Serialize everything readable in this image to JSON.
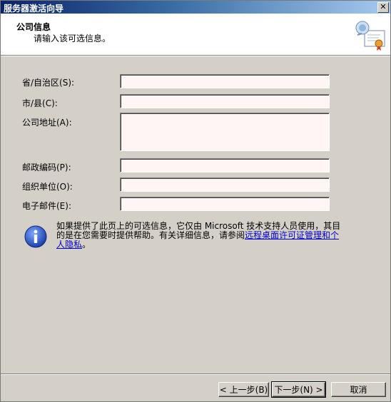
{
  "window": {
    "title": "服务器激活向导",
    "close": "✕"
  },
  "header": {
    "title": "公司信息",
    "subtitle": "请输入该可选信息。"
  },
  "form": {
    "province": "省/自治区(S):",
    "city": "市/县(C):",
    "address": "公司地址(A):",
    "postal": "邮政编码(P):",
    "org": "组织单位(O):",
    "email": "电子邮件(E):"
  },
  "values": {
    "province": "",
    "city": "",
    "address": "",
    "postal": "",
    "org": "",
    "email": ""
  },
  "info": {
    "text": "如果提供了此页上的可选信息，它仅由 Microsoft 技术支持人员使用，其目的是在您需要时提供帮助。有关详细信息，请参阅",
    "link": "远程桌面许可证管理和个人隐私",
    "end": "。"
  },
  "buttons": {
    "back": "< 上一步(B)",
    "next": "下一步(N) >",
    "cancel": "取消"
  },
  "colors": {
    "titlebar_start": "#0a246a",
    "titlebar_end": "#a6caf0",
    "field_bg": "#fff5f5",
    "link": "#0000cc"
  }
}
